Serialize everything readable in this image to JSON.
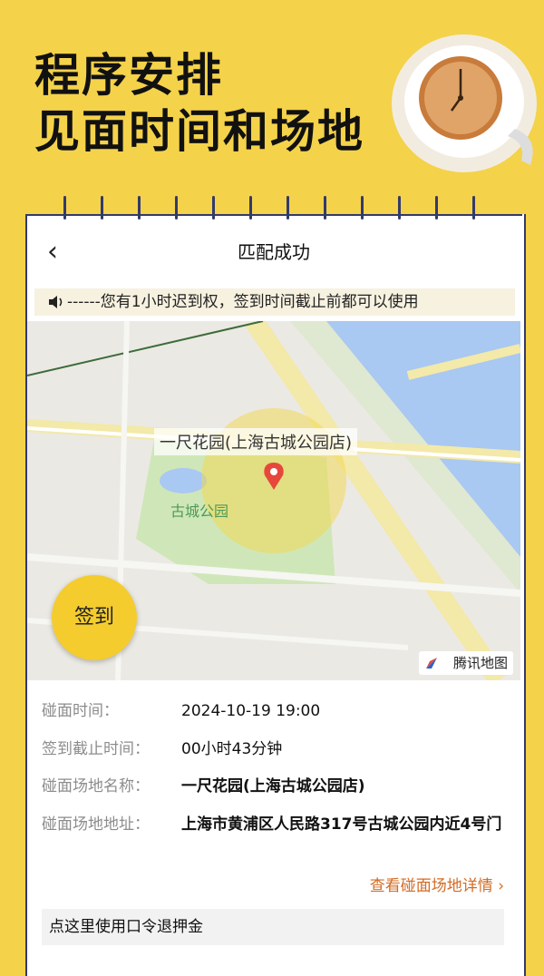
{
  "headline": {
    "line1": "程序安排",
    "line2": "见面时间和场地"
  },
  "nav": {
    "title": "匹配成功"
  },
  "notice": {
    "text": "------您有1小时迟到权，签到时间截止前都可以使用"
  },
  "map": {
    "place_label": "一尺花园(上海古城公园店)",
    "park_label": "古城公园",
    "logo_text": "腾讯地图",
    "checkin_label": "签到"
  },
  "details": {
    "meet_time": {
      "label": "碰面时间：",
      "value": "2024-10-19 19:00"
    },
    "deadline": {
      "label": "签到截止时间：",
      "value": "00小时43分钟"
    },
    "venue_name": {
      "label": "碰面场地名称：",
      "value": "一尺花园(上海古城公园店)"
    },
    "venue_address": {
      "label": "碰面场地地址：",
      "value": "上海市黄浦区人民路317号古城公园内近4号门"
    }
  },
  "detail_link": "查看碰面场地详情",
  "refund": {
    "text": "点这里使用口令退押金"
  },
  "colors": {
    "background": "#f4d24a",
    "binder": "#333a6a",
    "accent": "#d36b22",
    "button": "#f4cc2e"
  }
}
